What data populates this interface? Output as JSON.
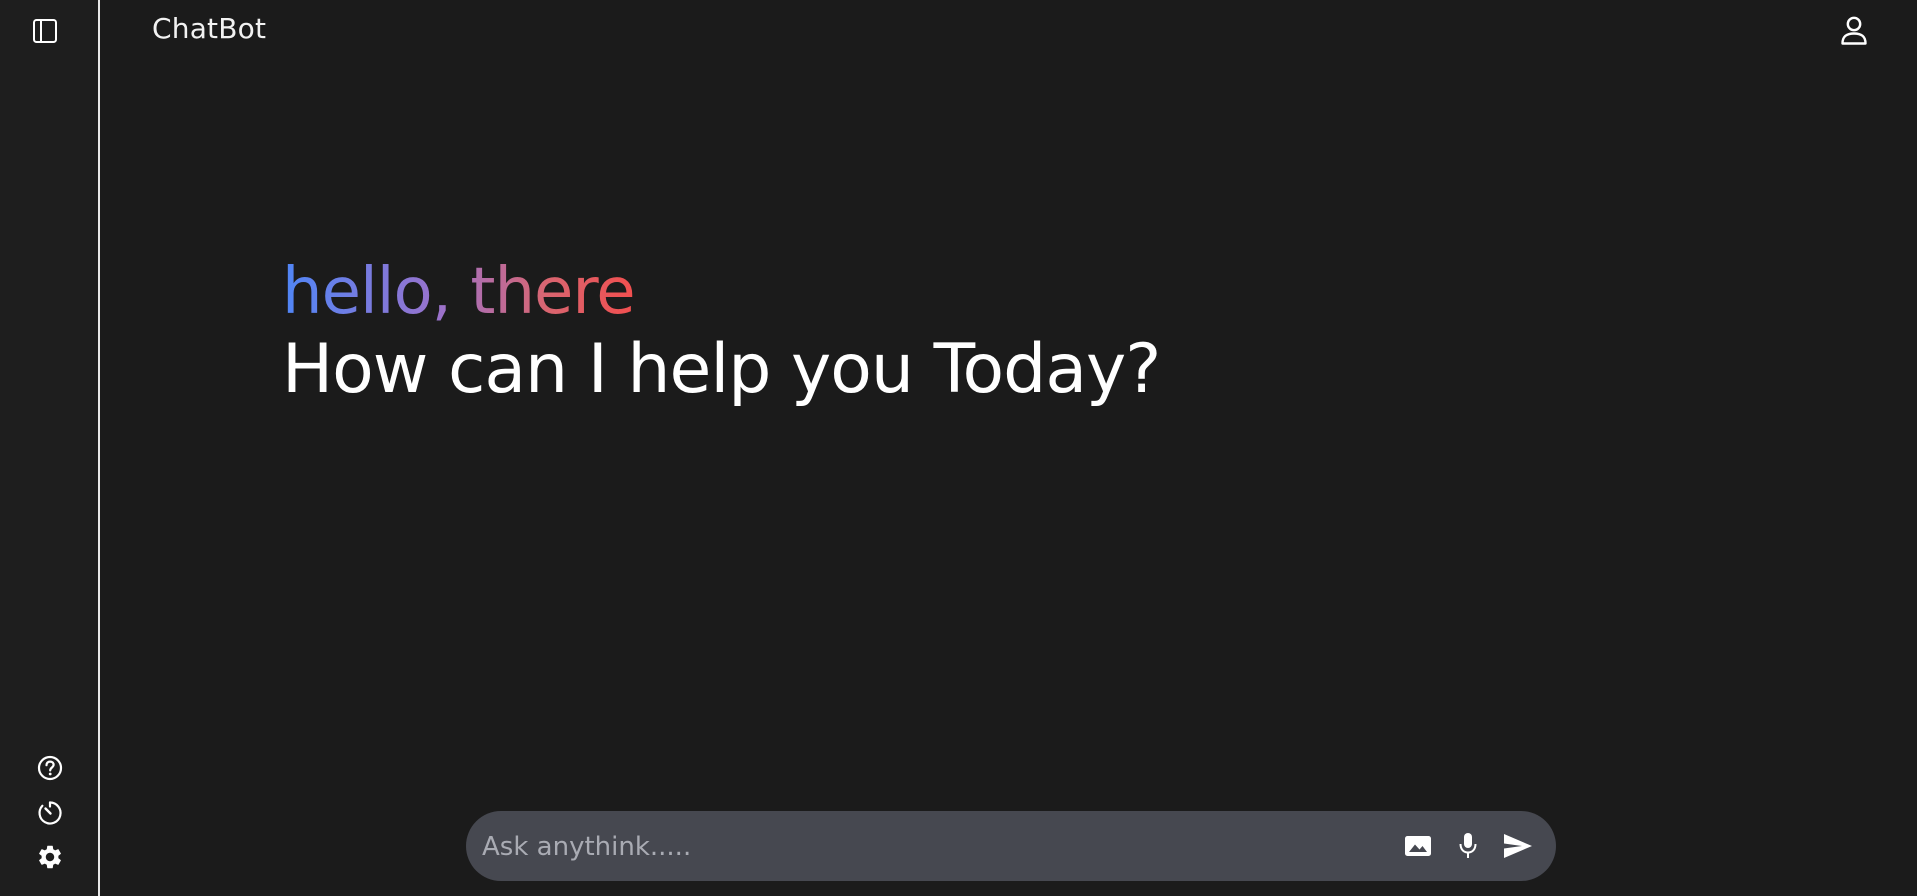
{
  "app": {
    "title": "ChatBot"
  },
  "sidebar": {
    "toggle_icon": "sidebar-panel-icon",
    "bottom_icons": [
      "help-circle-icon",
      "history-timer-icon",
      "settings-gear-icon"
    ]
  },
  "header": {
    "brand": "ChatBot",
    "profile_icon": "user-profile-icon"
  },
  "hero": {
    "greeting": "hello, there",
    "subheading": "How can I help you Today?"
  },
  "prompt": {
    "placeholder": "Ask anythink.....",
    "value": "",
    "icons": [
      "image-icon",
      "microphone-icon",
      "send-icon"
    ]
  },
  "colors": {
    "background": "#1b1b1b",
    "sidebar_border": "#e8e8e8",
    "prompt_bar": "#464850",
    "gradient_start": "#4f86f7",
    "gradient_mid": "#9b72cb",
    "gradient_end": "#f24f4f"
  }
}
